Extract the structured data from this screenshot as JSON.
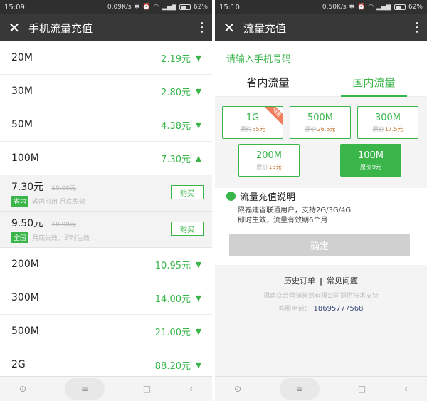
{
  "left": {
    "status": {
      "time": "15:09",
      "net": "0.09K/s",
      "battery": "62%"
    },
    "appbar": {
      "title": "手机流量充值"
    },
    "rows": [
      {
        "cap": "20M",
        "price": "2.19元"
      },
      {
        "cap": "30M",
        "price": "2.80元"
      },
      {
        "cap": "50M",
        "price": "4.38元"
      },
      {
        "cap": "100M",
        "price": "7.30元"
      }
    ],
    "subs": [
      {
        "price": "7.30元",
        "orig": "10.00元",
        "badge": "省内",
        "desc": "省内可用 月底失效",
        "buy": "购买"
      },
      {
        "price": "9.50元",
        "orig": "10.00元",
        "badge": "全国",
        "desc": "月底失效，即时生效",
        "buy": "购买"
      }
    ],
    "rows2": [
      {
        "cap": "200M",
        "price": "10.95元"
      },
      {
        "cap": "300M",
        "price": "14.00元"
      },
      {
        "cap": "500M",
        "price": "21.00元"
      },
      {
        "cap": "2G",
        "price": "88.20元"
      }
    ]
  },
  "right": {
    "status": {
      "time": "15:10",
      "net": "0.50K/s",
      "battery": "62%"
    },
    "appbar": {
      "title": "流量充值"
    },
    "phone_input_placeholder": "请输入手机号码",
    "tabs": [
      "省内流量",
      "国内流量"
    ],
    "options": [
      {
        "cap": "1G",
        "strike": "原价",
        "price": "55元",
        "corner": "特惠"
      },
      {
        "cap": "500M",
        "strike": "原价",
        "price": "26.5元"
      },
      {
        "cap": "300M",
        "strike": "原价",
        "price": "17.5元"
      },
      {
        "cap": "200M",
        "strike": "原价",
        "price": "13元"
      },
      {
        "cap": "100M",
        "strike": "原价",
        "price": "9元"
      }
    ],
    "info_title": "流量充值说明",
    "info_lines": [
      "限福建省联通用户，支持2G/3G/4G",
      "即时生效，流量有效期6个月"
    ],
    "confirm": "确定",
    "links": [
      "历史订单",
      "常见问题"
    ],
    "company": "福建众合营销策划有限公司提供技术支持",
    "tel_label": "客服电话：",
    "tel": "18695777568"
  },
  "icons": {
    "close": "close-icon",
    "more": "more-icon",
    "chevron": "chevron-icon",
    "info": "info-icon"
  },
  "colors": {
    "accent": "#39b54a",
    "appbar": "#383838",
    "statusbar": "#2f2f2f"
  }
}
